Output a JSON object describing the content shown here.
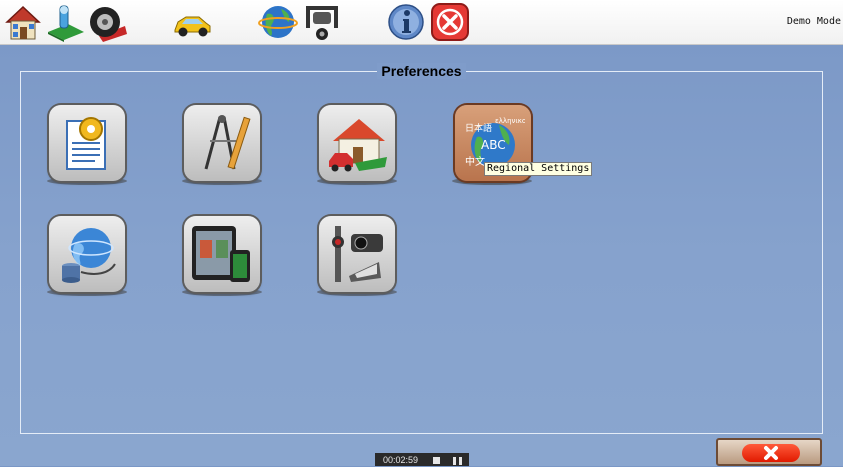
{
  "toolbar": {
    "buttons": [
      {
        "icon": "home-icon"
      },
      {
        "icon": "lift-adjust-icon"
      },
      {
        "icon": "tire-icon"
      },
      {
        "icon": "car-icon"
      },
      {
        "icon": "globe-icon"
      },
      {
        "icon": "wheel-alignment-icon"
      },
      {
        "icon": "info-icon"
      },
      {
        "icon": "close-icon"
      }
    ],
    "mode_label": "Demo Mode"
  },
  "panel": {
    "title": "Preferences",
    "tiles": [
      {
        "icon": "settings-document-icon"
      },
      {
        "icon": "drafting-tools-icon"
      },
      {
        "icon": "garage-house-icon"
      },
      {
        "icon": "regional-settings-icon"
      },
      {
        "icon": "network-database-icon"
      },
      {
        "icon": "tablet-devices-icon"
      },
      {
        "icon": "sensor-camera-icon"
      }
    ],
    "tooltip": "Regional Settings"
  },
  "regional_icon_text": {
    "ja": "日本語",
    "greek": "ελληνικο",
    "abc": "ABC",
    "zh": "中文"
  },
  "status_bar": {
    "timer": "00:02:59"
  },
  "colors": {
    "background": "#86a2cd",
    "close_red": "#e11a00",
    "toolbar": "#f4f4f4"
  }
}
